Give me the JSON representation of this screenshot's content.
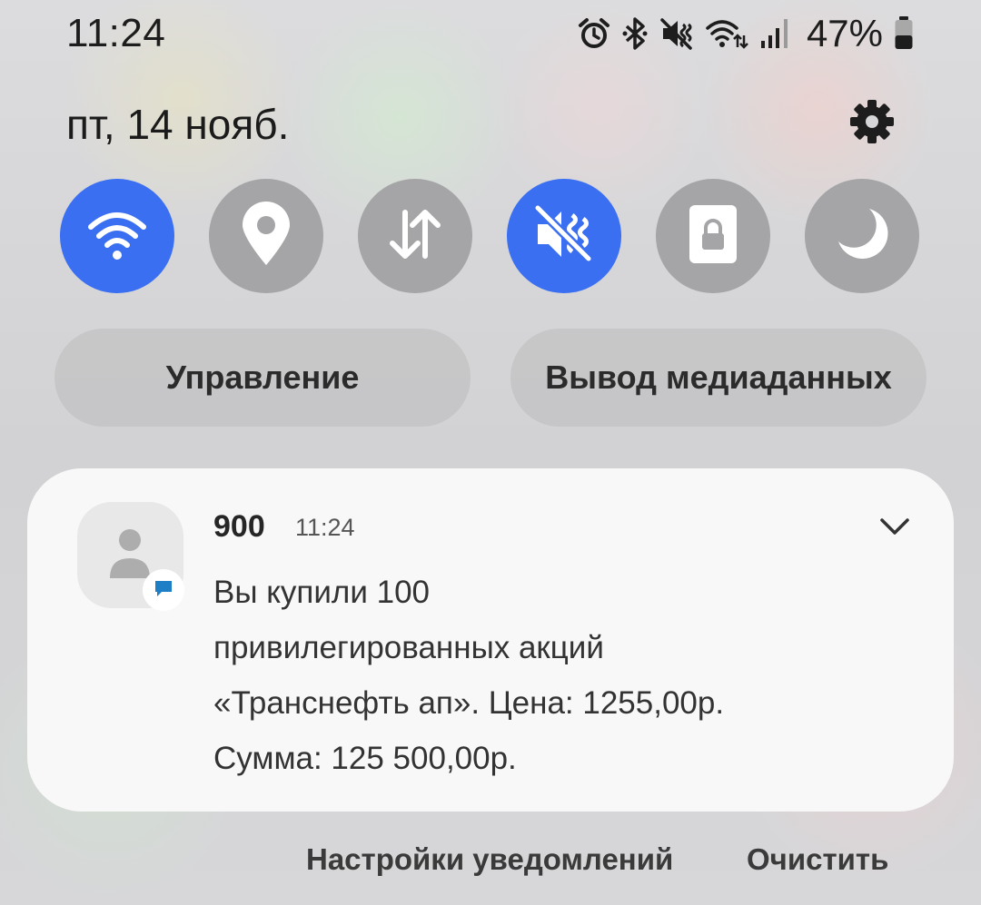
{
  "status_bar": {
    "time": "11:24",
    "battery_percent": "47%",
    "battery_level": 0.47,
    "icons": [
      "alarm-icon",
      "bluetooth-icon",
      "mute-icon",
      "wifi-data-icon",
      "cellular-signal-icon",
      "battery-icon"
    ]
  },
  "header": {
    "date": "пт, 14 нояб.",
    "settings_icon": "gear-icon"
  },
  "quick_toggles": [
    {
      "name": "wifi",
      "icon": "wifi-icon",
      "active": true
    },
    {
      "name": "location",
      "icon": "location-pin-icon",
      "active": false
    },
    {
      "name": "mobile-data",
      "icon": "data-arrows-icon",
      "active": false
    },
    {
      "name": "sound-mode",
      "icon": "vibrate-mute-icon",
      "active": true
    },
    {
      "name": "secure-folder",
      "icon": "lock-icon",
      "active": false
    },
    {
      "name": "dark-mode",
      "icon": "moon-icon",
      "active": false
    }
  ],
  "buttons": {
    "device_control": "Управление",
    "media_output": "Вывод медиаданных"
  },
  "notification": {
    "sender": "900",
    "time": "11:24",
    "lines": [
      "Вы купили 100",
      "привилегированных акций",
      "«Транснефть ап». Цена: 1255,00р.",
      "Сумма: 125 500,00р."
    ]
  },
  "footer": {
    "notification_settings": "Настройки уведомлений",
    "clear": "Очистить"
  },
  "colors": {
    "accent": "#3b6ff1",
    "toggle_off": "#a5a5a7"
  }
}
